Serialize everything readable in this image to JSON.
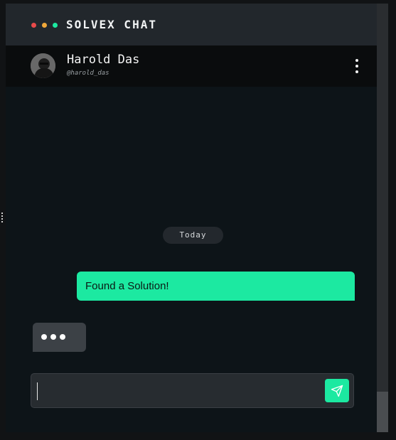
{
  "app": {
    "title": "SOLVEX CHAT",
    "window_dots": [
      "#e84a4a",
      "#f0a83a",
      "#1ce9a1"
    ]
  },
  "contact": {
    "name": "Harold Das",
    "handle": "@harold_das",
    "avatar_icon": "user-avatar-icon"
  },
  "header": {
    "menu_icon": "more-vertical-icon"
  },
  "conversation": {
    "date_label": "Today",
    "messages": [
      {
        "direction": "outgoing",
        "text": "Found a Solution!"
      }
    ],
    "typing_indicator": true
  },
  "composer": {
    "value": "",
    "placeholder": "",
    "send_icon": "send-icon"
  },
  "colors": {
    "accent": "#1ce9a1",
    "background": "#0d1418",
    "titlebar": "#22272c",
    "header": "#0a0c0d",
    "incoming_bubble": "#3c4146"
  }
}
